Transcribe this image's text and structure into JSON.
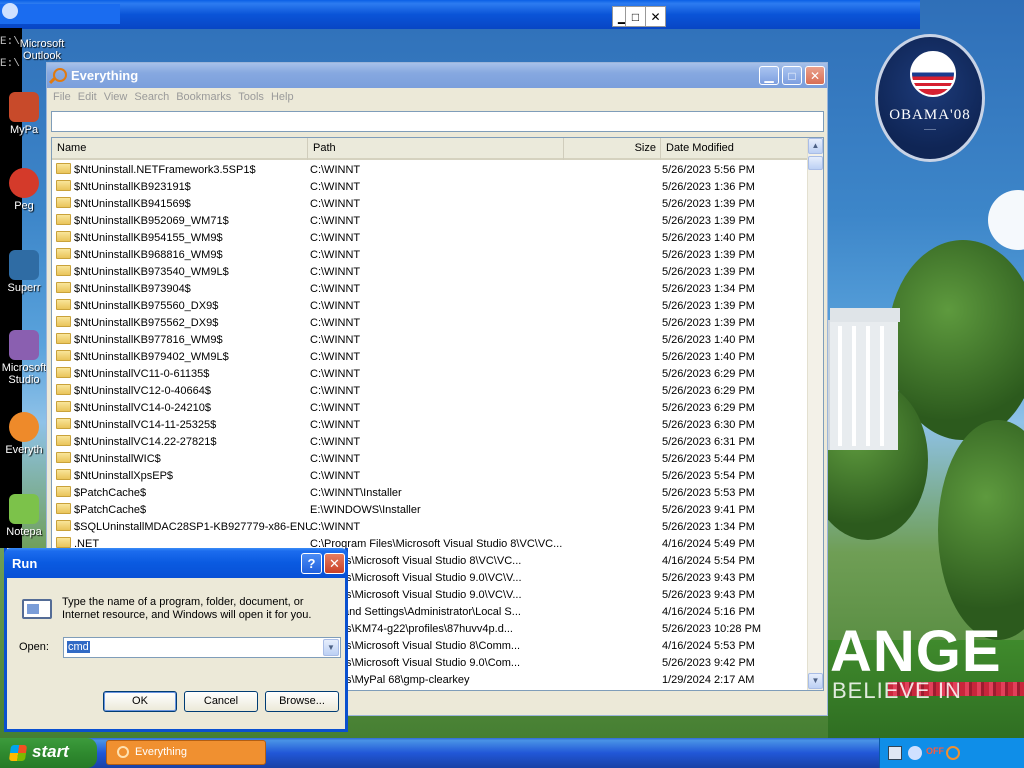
{
  "window_title": "Everything",
  "menu": [
    "File",
    "Edit",
    "View",
    "Search",
    "Bookmarks",
    "Tools",
    "Help"
  ],
  "search": {
    "value": ""
  },
  "columns": {
    "name": "Name",
    "path": "Path",
    "size": "Size",
    "date": "Date Modified"
  },
  "rows": [
    {
      "name": "$NtUninstall.NETFramework3.5SP1$",
      "path": "C:\\WINNT",
      "date": "5/26/2023 5:56 PM"
    },
    {
      "name": "$NtUninstallKB923191$",
      "path": "C:\\WINNT",
      "date": "5/26/2023 1:36 PM"
    },
    {
      "name": "$NtUninstallKB941569$",
      "path": "C:\\WINNT",
      "date": "5/26/2023 1:39 PM"
    },
    {
      "name": "$NtUninstallKB952069_WM71$",
      "path": "C:\\WINNT",
      "date": "5/26/2023 1:39 PM"
    },
    {
      "name": "$NtUninstallKB954155_WM9$",
      "path": "C:\\WINNT",
      "date": "5/26/2023 1:40 PM"
    },
    {
      "name": "$NtUninstallKB968816_WM9$",
      "path": "C:\\WINNT",
      "date": "5/26/2023 1:39 PM"
    },
    {
      "name": "$NtUninstallKB973540_WM9L$",
      "path": "C:\\WINNT",
      "date": "5/26/2023 1:39 PM"
    },
    {
      "name": "$NtUninstallKB973904$",
      "path": "C:\\WINNT",
      "date": "5/26/2023 1:34 PM"
    },
    {
      "name": "$NtUninstallKB975560_DX9$",
      "path": "C:\\WINNT",
      "date": "5/26/2023 1:39 PM"
    },
    {
      "name": "$NtUninstallKB975562_DX9$",
      "path": "C:\\WINNT",
      "date": "5/26/2023 1:39 PM"
    },
    {
      "name": "$NtUninstallKB977816_WM9$",
      "path": "C:\\WINNT",
      "date": "5/26/2023 1:40 PM"
    },
    {
      "name": "$NtUninstallKB979402_WM9L$",
      "path": "C:\\WINNT",
      "date": "5/26/2023 1:40 PM"
    },
    {
      "name": "$NtUninstallVC11-0-61135$",
      "path": "C:\\WINNT",
      "date": "5/26/2023 6:29 PM"
    },
    {
      "name": "$NtUninstallVC12-0-40664$",
      "path": "C:\\WINNT",
      "date": "5/26/2023 6:29 PM"
    },
    {
      "name": "$NtUninstallVC14-0-24210$",
      "path": "C:\\WINNT",
      "date": "5/26/2023 6:29 PM"
    },
    {
      "name": "$NtUninstallVC14-11-25325$",
      "path": "C:\\WINNT",
      "date": "5/26/2023 6:30 PM"
    },
    {
      "name": "$NtUninstallVC14.22-27821$",
      "path": "C:\\WINNT",
      "date": "5/26/2023 6:31 PM"
    },
    {
      "name": "$NtUninstallWIC$",
      "path": "C:\\WINNT",
      "date": "5/26/2023 5:44 PM"
    },
    {
      "name": "$NtUninstallXpsEP$",
      "path": "C:\\WINNT",
      "date": "5/26/2023 5:54 PM"
    },
    {
      "name": "$PatchCache$",
      "path": "C:\\WINNT\\Installer",
      "date": "5/26/2023 5:53 PM"
    },
    {
      "name": "$PatchCache$",
      "path": "E:\\WINDOWS\\Installer",
      "date": "5/26/2023 9:41 PM"
    },
    {
      "name": "$SQLUninstallMDAC28SP1-KB927779-x86-ENU$",
      "path": "C:\\WINNT",
      "date": "5/26/2023 1:34 PM"
    },
    {
      "name": ".NET",
      "path": "C:\\Program Files\\Microsoft Visual Studio 8\\VC\\VC...",
      "date": "4/16/2024 5:49 PM"
    },
    {
      "name": "",
      "path": "am Files\\Microsoft Visual Studio 8\\VC\\VC...",
      "date": "4/16/2024 5:54 PM"
    },
    {
      "name": "",
      "path": "am Files\\Microsoft Visual Studio 9.0\\VC\\V...",
      "date": "5/26/2023 9:43 PM"
    },
    {
      "name": "",
      "path": "am Files\\Microsoft Visual Studio 9.0\\VC\\V...",
      "date": "5/26/2023 9:43 PM"
    },
    {
      "name": "",
      "path": "ments and Settings\\Administrator\\Local S...",
      "date": "4/16/2024 5:16 PM"
    },
    {
      "name": "",
      "path": "am Files\\KM74-g22\\profiles\\87huvv4p.d...",
      "date": "5/26/2023 10:28 PM"
    },
    {
      "name": "",
      "path": "am Files\\Microsoft Visual Studio 8\\Comm...",
      "date": "4/16/2024 5:53 PM"
    },
    {
      "name": "",
      "path": "am Files\\Microsoft Visual Studio 9.0\\Com...",
      "date": "5/26/2023 9:42 PM"
    },
    {
      "name": "",
      "path": "am Files\\MyPal 68\\gmp-clearkey",
      "date": "1/29/2024 2:17 AM"
    }
  ],
  "run_dialog": {
    "title": "Run",
    "help_label": "?",
    "description": "Type the name of a program, folder, document, or Internet resource, and Windows will open it for you.",
    "open_label": "Open:",
    "open_value": "cmd",
    "ok_label": "OK",
    "cancel_label": "Cancel",
    "browse_label": "Browse..."
  },
  "desktop": {
    "cmd_lines": [
      "E:\\",
      "E:\\"
    ],
    "icons": [
      {
        "label": "Microsoft Outlook",
        "icon": "outlook-icon"
      },
      {
        "label": "MyPa",
        "icon": "mypal-icon"
      },
      {
        "label": "Peg",
        "icon": "pegasus-icon"
      },
      {
        "label": "Superr",
        "icon": "super-icon"
      },
      {
        "label": "Microsoft Studio",
        "icon": "visual-studio-icon"
      },
      {
        "label": "Everyth",
        "icon": "everything-icon"
      },
      {
        "label": "Notepa",
        "icon": "notepad-icon"
      }
    ],
    "wallpaper_logo_text": "OBAMA'08",
    "wallpaper_text_1": "ANGE",
    "wallpaper_text_2": "BELIEVE IN"
  },
  "taskbar": {
    "start_label": "start",
    "items": [
      "Everything"
    ],
    "tray_text": "OFF"
  },
  "colors": {
    "xp_blue": "#0a54d8",
    "start_green": "#2f8a2f",
    "taskbar_active": "#f09030",
    "selection": "#316ac5"
  }
}
